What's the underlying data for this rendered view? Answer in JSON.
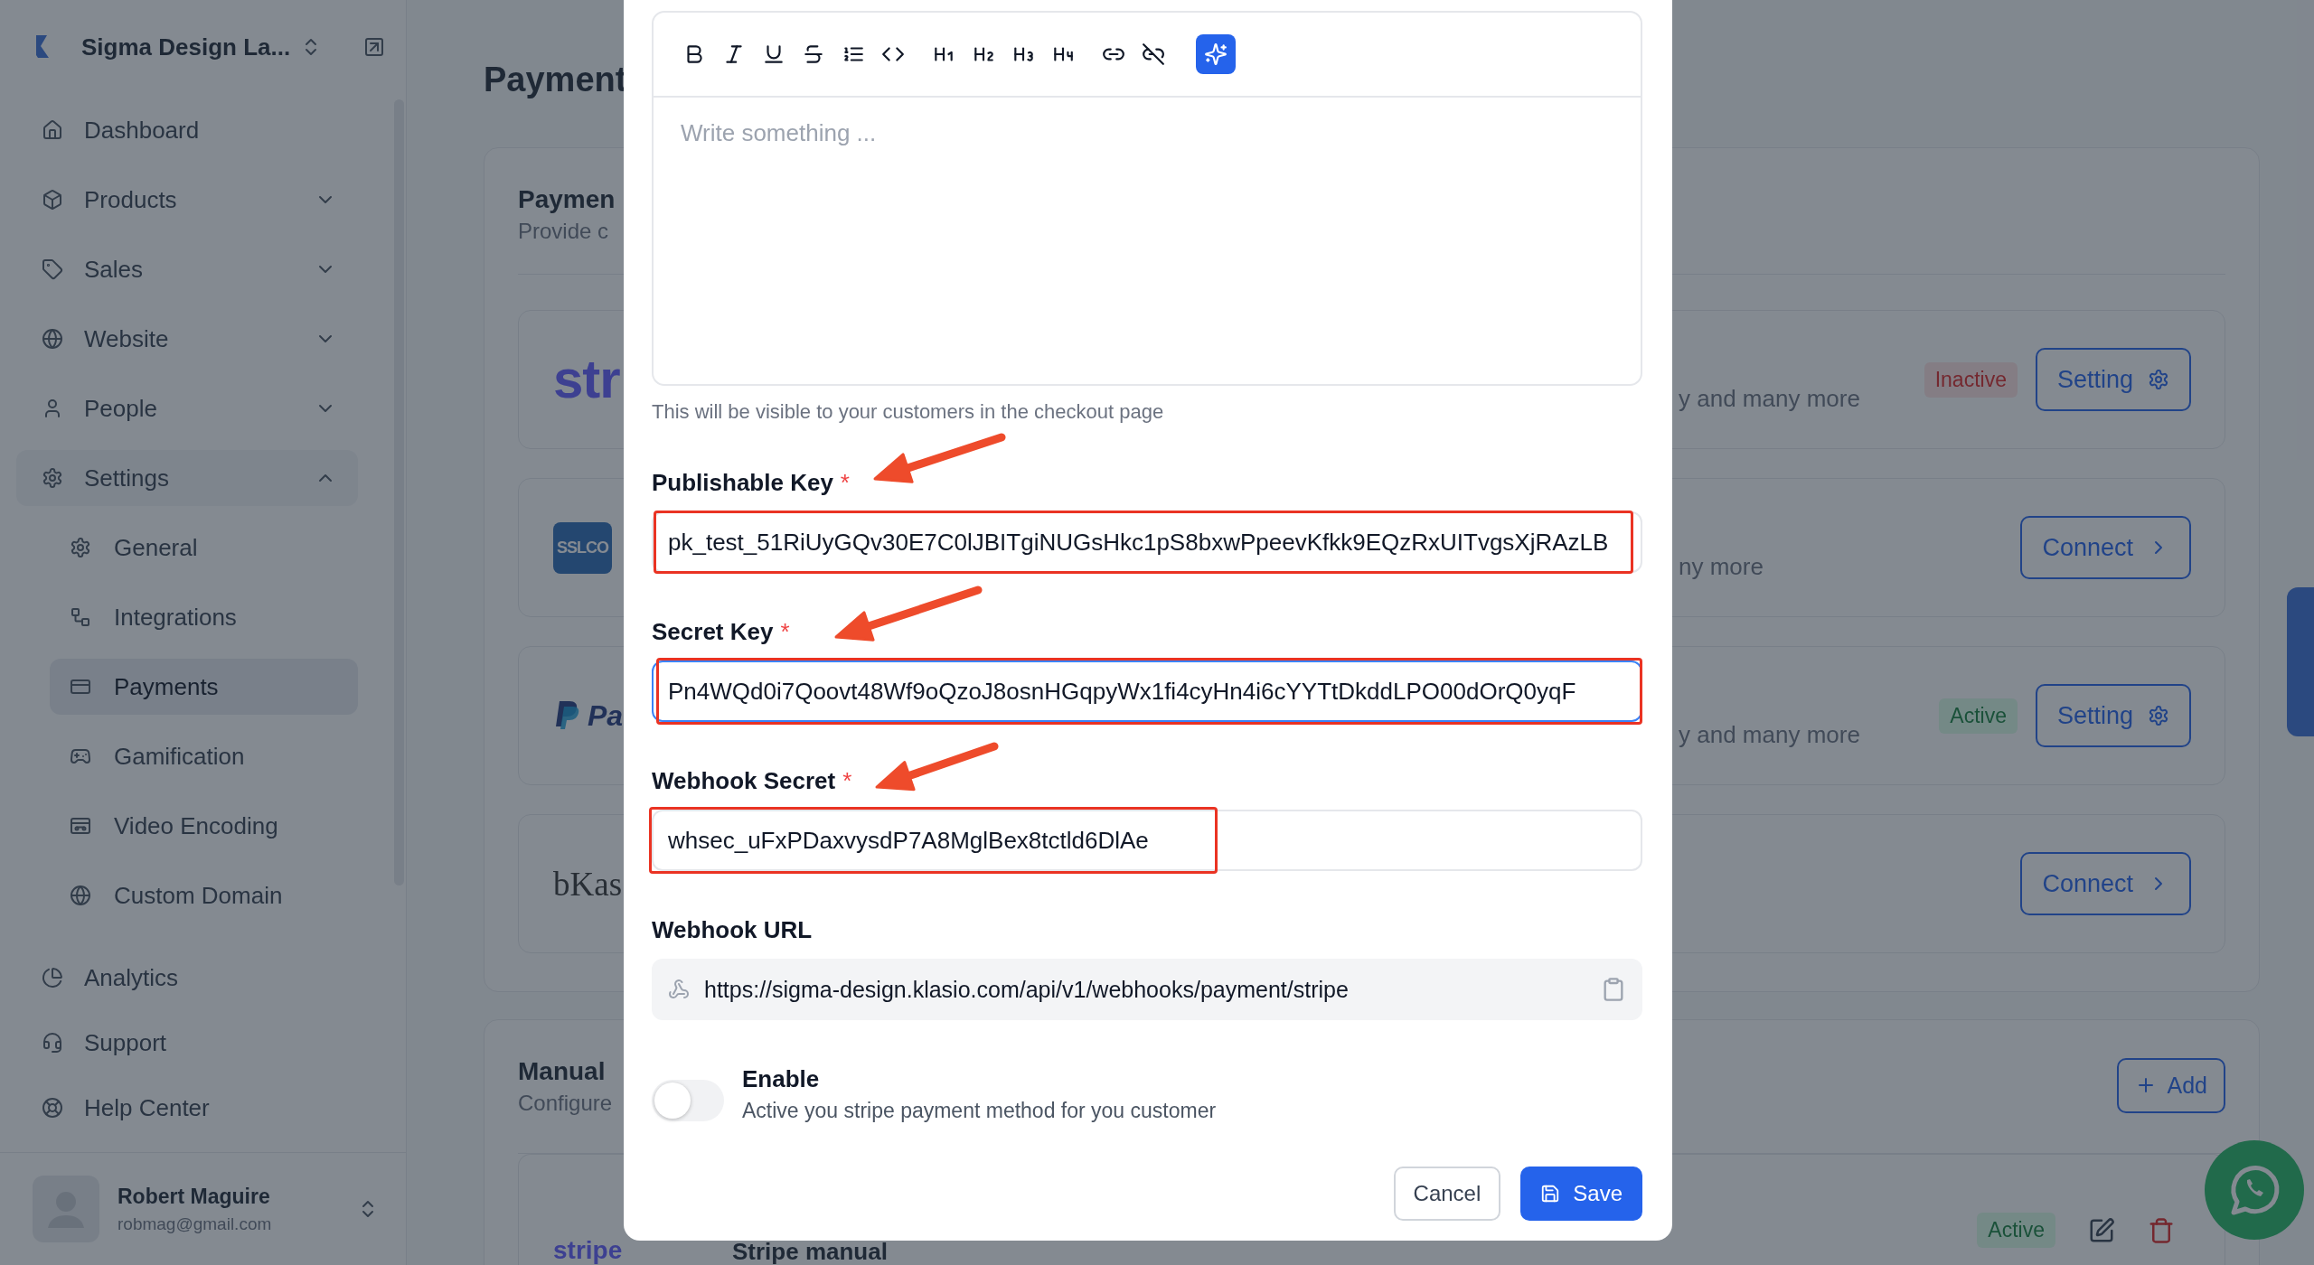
{
  "sidebar": {
    "workspace": "Sigma Design La...",
    "nav": [
      {
        "label": "Dashboard",
        "selected": false
      },
      {
        "label": "Products",
        "selected": false,
        "expanded": false
      },
      {
        "label": "Sales",
        "selected": false,
        "expanded": false
      },
      {
        "label": "Website",
        "selected": false,
        "expanded": false
      },
      {
        "label": "People",
        "selected": false,
        "expanded": false
      },
      {
        "label": "Settings",
        "selected": false,
        "expanded": true,
        "children": [
          {
            "label": "General",
            "selected": false
          },
          {
            "label": "Integrations",
            "selected": false
          },
          {
            "label": "Payments",
            "selected": true
          },
          {
            "label": "Gamification",
            "selected": false
          },
          {
            "label": "Video Encoding",
            "selected": false
          },
          {
            "label": "Custom Domain",
            "selected": false
          }
        ]
      }
    ],
    "secondary_nav": [
      {
        "label": "Analytics",
        "selected": false
      },
      {
        "label": "Support",
        "selected": false
      },
      {
        "label": "Help Center",
        "selected": false
      }
    ],
    "user": {
      "name": "Robert Maguire",
      "email": "robmag@gmail.com"
    }
  },
  "page": {
    "title": "Payment"
  },
  "gateways_card": {
    "title": "Paymen",
    "subtitle": "Provide c",
    "providers": [
      {
        "kind": "stripe",
        "logo_text": "str",
        "description": "y and many more",
        "status": {
          "label": "Inactive",
          "kind": "inactive"
        },
        "action": {
          "label": "Setting",
          "kind": "setting"
        }
      },
      {
        "kind": "sslcommerz",
        "logo_text": "SSLCO",
        "description": "ny more",
        "action": {
          "label": "Connect",
          "kind": "connect"
        }
      },
      {
        "kind": "paypal",
        "logo_text": "Pa",
        "description": "y and many more",
        "status": {
          "label": "Active",
          "kind": "active"
        },
        "action": {
          "label": "Setting",
          "kind": "setting"
        }
      },
      {
        "kind": "bkash",
        "logo_text": "bKas",
        "action": {
          "label": "Connect",
          "kind": "connect"
        }
      }
    ]
  },
  "manual_card": {
    "title": "Manual",
    "subtitle": "Configure",
    "add_button": "Add",
    "methods": [
      {
        "logo_text": "stripe",
        "name": "Stripe manual",
        "status": {
          "label": "Active",
          "kind": "active"
        }
      }
    ]
  },
  "modal": {
    "editor": {
      "placeholder": "Write something ...",
      "hint": "This will be visible to your customers in the checkout page"
    },
    "fields": [
      {
        "kind": "input",
        "label": "Publishable Key",
        "required_mark": "*",
        "value": "pk_test_51RiUyGQv30E7C0lJBITgiNUGsHkc1pS8bxwPpeevKfkk9EQzRxUITvgsXjRAzLB",
        "focused": false,
        "annotated": true
      },
      {
        "kind": "input",
        "label": "Secret Key",
        "required_mark": "*",
        "value": "Pn4WQd0i7Qoovt48Wf9oQzoJ8osnHGqpyWx1fi4cyHn4i6cYYTtDkddLPO00dOrQ0yqF",
        "focused": true,
        "annotated": true
      },
      {
        "kind": "input",
        "label": "Webhook Secret",
        "required_mark": "*",
        "value": "whsec_uFxPDaxvysdP7A8MglBex8tctld6DlAe",
        "focused": false,
        "annotated": true
      },
      {
        "kind": "copy",
        "label": "Webhook URL",
        "value": "https://sigma-design.klasio.com/api/v1/webhooks/payment/stripe",
        "focused": false,
        "annotated": false
      }
    ],
    "toggle": {
      "label": "Enable",
      "description": "Active you stripe payment method for you customer",
      "on": false
    },
    "buttons": [
      {
        "label": "Cancel",
        "kind": "secondary"
      },
      {
        "label": "Save",
        "kind": "primary"
      }
    ]
  }
}
